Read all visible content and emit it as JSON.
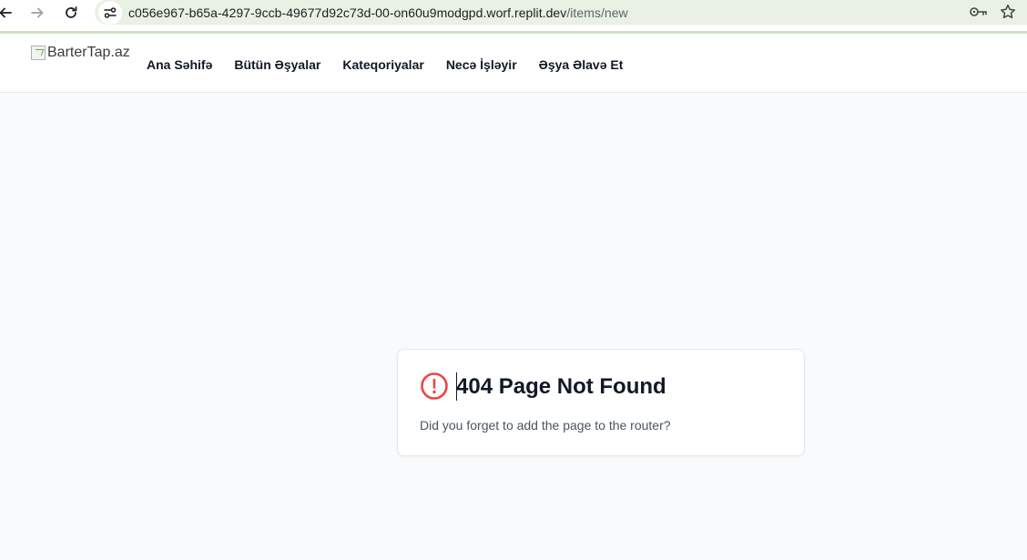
{
  "browser": {
    "url_host": "c056e967-b65a-4297-9ccb-49677d92c73d-00-on60u9modgpd.worf.replit.dev",
    "url_path": "/items/new",
    "icons": [
      "back-arrow-icon",
      "forward-arrow-icon",
      "reload-icon",
      "site-info-icon",
      "key-icon",
      "star-icon"
    ]
  },
  "header": {
    "logo_alt": "BarterTap.az",
    "nav": [
      {
        "label": "Ana Səhifə"
      },
      {
        "label": "Bütün Əşyalar"
      },
      {
        "label": "Kateqoriyalar"
      },
      {
        "label": "Necə İşləyir"
      },
      {
        "label": "Əşya Əlavə Et"
      }
    ]
  },
  "error_card": {
    "title": "404 Page Not Found",
    "description": "Did you forget to add the page to the router?",
    "icon": "alert-circle-icon"
  },
  "colors": {
    "page_background": "#f9fafb",
    "address_bar": "#e8f1e4",
    "alert_red": "#ef4444",
    "text_primary": "#111827",
    "text_secondary": "#4b5563"
  }
}
